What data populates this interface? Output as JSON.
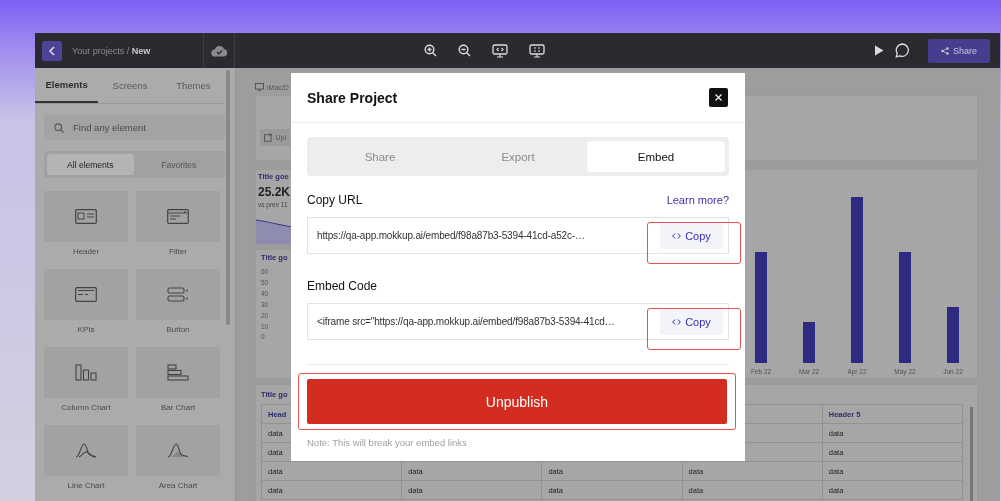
{
  "top_bar": {
    "breadcrumb": "Your projects / **New**",
    "share_button": "Share"
  },
  "sidebar": {
    "tabs": [
      {
        "label": "Elements",
        "selected": true
      },
      {
        "label": "Screens",
        "selected": false
      },
      {
        "label": "Themes",
        "selected": false
      }
    ],
    "search": {
      "placeholder": "Find any element"
    },
    "filters": [
      {
        "label": "All elements",
        "selected": true
      },
      {
        "label": "Favorites",
        "selected": false
      }
    ],
    "elements": [
      {
        "label": "Header",
        "kind": "header"
      },
      {
        "label": "Filter",
        "kind": "filter"
      },
      {
        "label": "KPIs",
        "kind": "kpi"
      },
      {
        "label": "Button",
        "kind": "button"
      },
      {
        "label": "Column Chart",
        "kind": "column"
      },
      {
        "label": "Bar Chart",
        "kind": "bar"
      },
      {
        "label": "Line Chart",
        "kind": "line"
      },
      {
        "label": "Area Chart",
        "kind": "area"
      }
    ]
  },
  "canvas": {
    "device_label": "iMac/D",
    "upload_button": "Upl",
    "kpi": {
      "title": "Title goe",
      "value": "25.2K",
      "comparison": "vs prev 11"
    },
    "axis_chart": {
      "title": "Title go",
      "y_ticks": [
        "60",
        "50",
        "40",
        "30",
        "20",
        "10",
        "0"
      ]
    },
    "bar_chart": {
      "x_labels": [
        "Feb 22",
        "Mar 22",
        "Apr 22",
        "May 22",
        "Jun 22"
      ]
    },
    "table": {
      "title": "Title go",
      "columns": [
        "Head",
        null,
        null,
        null,
        "Header 5"
      ],
      "rows": [
        [
          "data",
          null,
          null,
          null,
          "data"
        ],
        [
          "data",
          null,
          null,
          null,
          "data"
        ],
        [
          "data",
          "data",
          "data",
          "data",
          "data"
        ],
        [
          "data",
          "data",
          "data",
          "data",
          "data"
        ]
      ]
    }
  },
  "modal": {
    "title": "Share Project",
    "tabs": [
      {
        "label": "Share",
        "selected": false
      },
      {
        "label": "Export",
        "selected": false
      },
      {
        "label": "Embed",
        "selected": true
      }
    ],
    "url": {
      "label": "Copy URL",
      "link": "Learn more?",
      "value": "https://qa-app.mokkup.ai/embed/f98a87b3-5394-41cd-a52c-…",
      "button": "Copy",
      "highlighted": true
    },
    "embed": {
      "label": "Embed Code",
      "value": "<iframe src=\"https://qa-app.mokkup.ai/embed/f98a87b3-5394-41cd…",
      "button": "Copy",
      "highlighted": true
    },
    "unpublish": {
      "button": "Unpublish",
      "highlighted": true
    },
    "note": "Note: This will break your embed links"
  }
}
